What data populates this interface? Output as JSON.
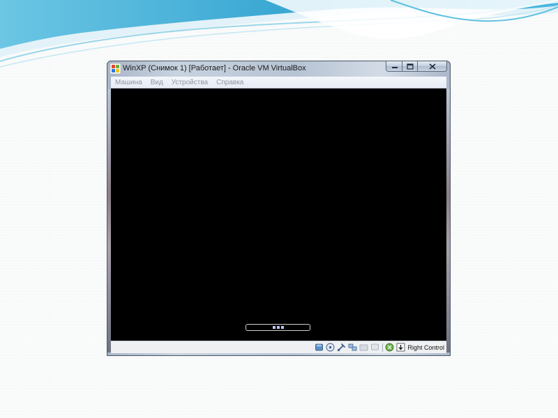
{
  "window": {
    "title": "WinXP (Снимок 1) [Работает] - Oracle VM VirtualBox"
  },
  "menu": {
    "items": [
      "Машина",
      "Вид",
      "Устройства",
      "Справка"
    ]
  },
  "status_bar": {
    "host_key_label": "Right Control",
    "icons": [
      "hard-disk-icon",
      "cd-drive-icon",
      "usb-icon",
      "network-icon",
      "shared-folders-icon",
      "display-icon",
      "mouse-integration-icon",
      "host-key-arrow-icon"
    ]
  },
  "boot_screen": {
    "progress_indicator": "three blue dots"
  },
  "colors": {
    "vm_screen": "#000000",
    "menu_text_disabled": "#8c95a3",
    "wave_primary": "#3fb1d6",
    "wave_light": "#bfe6f2"
  }
}
